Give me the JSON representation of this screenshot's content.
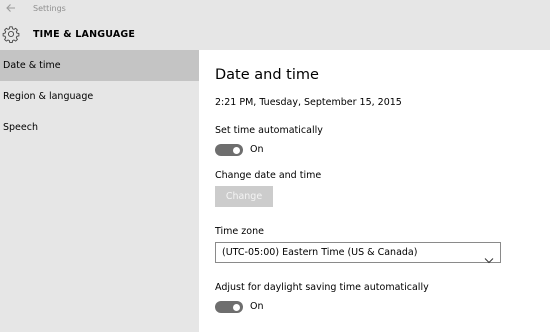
{
  "window": {
    "title": "Settings"
  },
  "header": {
    "title": "TIME & LANGUAGE",
    "icon": "gear-icon"
  },
  "sidebar": {
    "items": [
      {
        "label": "Date & time",
        "selected": true
      },
      {
        "label": "Region & language",
        "selected": false
      },
      {
        "label": "Speech",
        "selected": false
      }
    ]
  },
  "main": {
    "title": "Date and time",
    "current_datetime": "2:21 PM, Tuesday, September 15, 2015",
    "set_time_auto": {
      "label": "Set time automatically",
      "state": "On",
      "on": true
    },
    "change_datetime": {
      "label": "Change date and time",
      "button": "Change",
      "enabled": false
    },
    "timezone": {
      "label": "Time zone",
      "value": "(UTC-05:00) Eastern Time (US & Canada)"
    },
    "dst_auto": {
      "label": "Adjust for daylight saving time automatically",
      "state": "On",
      "on": true
    }
  },
  "colors": {
    "chrome_bg": "#e6e6e6",
    "selected_bg": "#c4c4c4",
    "toggle_on": "#6e6e6e",
    "disabled_button": "#cccccc"
  }
}
